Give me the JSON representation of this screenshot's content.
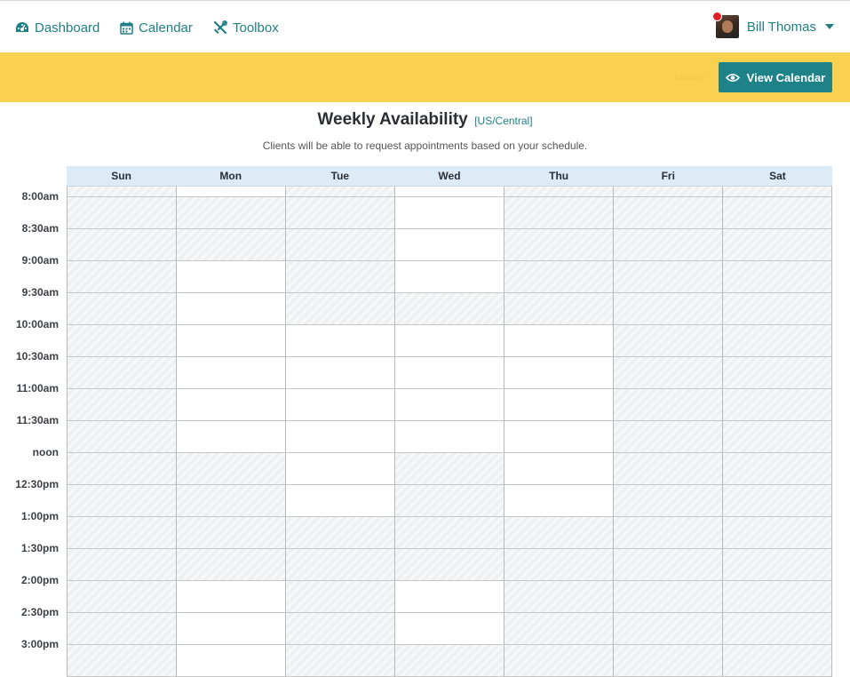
{
  "nav": {
    "dashboard": "Dashboard",
    "calendar": "Calendar",
    "toolbox": "Toolbox",
    "user_name": "Bill Thomas"
  },
  "banner": {
    "view_calendar": "View Calendar",
    "ghost_text": "Library"
  },
  "page": {
    "title": "Weekly Availability",
    "timezone": "[US/Central]",
    "subtitle": "Clients will be able to request appointments based on your schedule."
  },
  "days": [
    "Sun",
    "Mon",
    "Tue",
    "Wed",
    "Thu",
    "Fri",
    "Sat"
  ],
  "times": [
    "8:00am",
    "8:30am",
    "9:00am",
    "9:30am",
    "10:00am",
    "10:30am",
    "11:00am",
    "11:30am",
    "noon",
    "12:30pm",
    "1:00pm",
    "1:30pm",
    "2:00pm",
    "2:30pm",
    "3:00pm"
  ],
  "availability": {
    "Sun": [
      0,
      0,
      0,
      0,
      0,
      0,
      0,
      0,
      0,
      0,
      0,
      0,
      0,
      0,
      0,
      0
    ],
    "Mon": [
      1,
      0,
      0,
      1,
      1,
      1,
      1,
      1,
      1,
      0,
      0,
      0,
      0,
      1,
      1,
      1
    ],
    "Tue": [
      0,
      0,
      0,
      0,
      0,
      1,
      1,
      1,
      1,
      1,
      1,
      0,
      0,
      0,
      0,
      0
    ],
    "Wed": [
      1,
      1,
      1,
      1,
      0,
      1,
      1,
      1,
      1,
      0,
      0,
      0,
      0,
      1,
      1,
      0
    ],
    "Thu": [
      0,
      0,
      0,
      0,
      0,
      1,
      1,
      1,
      1,
      1,
      1,
      0,
      0,
      0,
      0,
      0
    ],
    "Fri": [
      0,
      0,
      0,
      0,
      0,
      0,
      0,
      0,
      0,
      0,
      0,
      0,
      0,
      0,
      0,
      0
    ],
    "Sat": [
      0,
      0,
      0,
      0,
      0,
      0,
      0,
      0,
      0,
      0,
      0,
      0,
      0,
      0,
      0,
      0
    ]
  },
  "colors": {
    "accent": "#1f8289",
    "banner": "#f9d04f",
    "header_bg": "#dcebf5",
    "unavailable": "#eef0f2"
  }
}
